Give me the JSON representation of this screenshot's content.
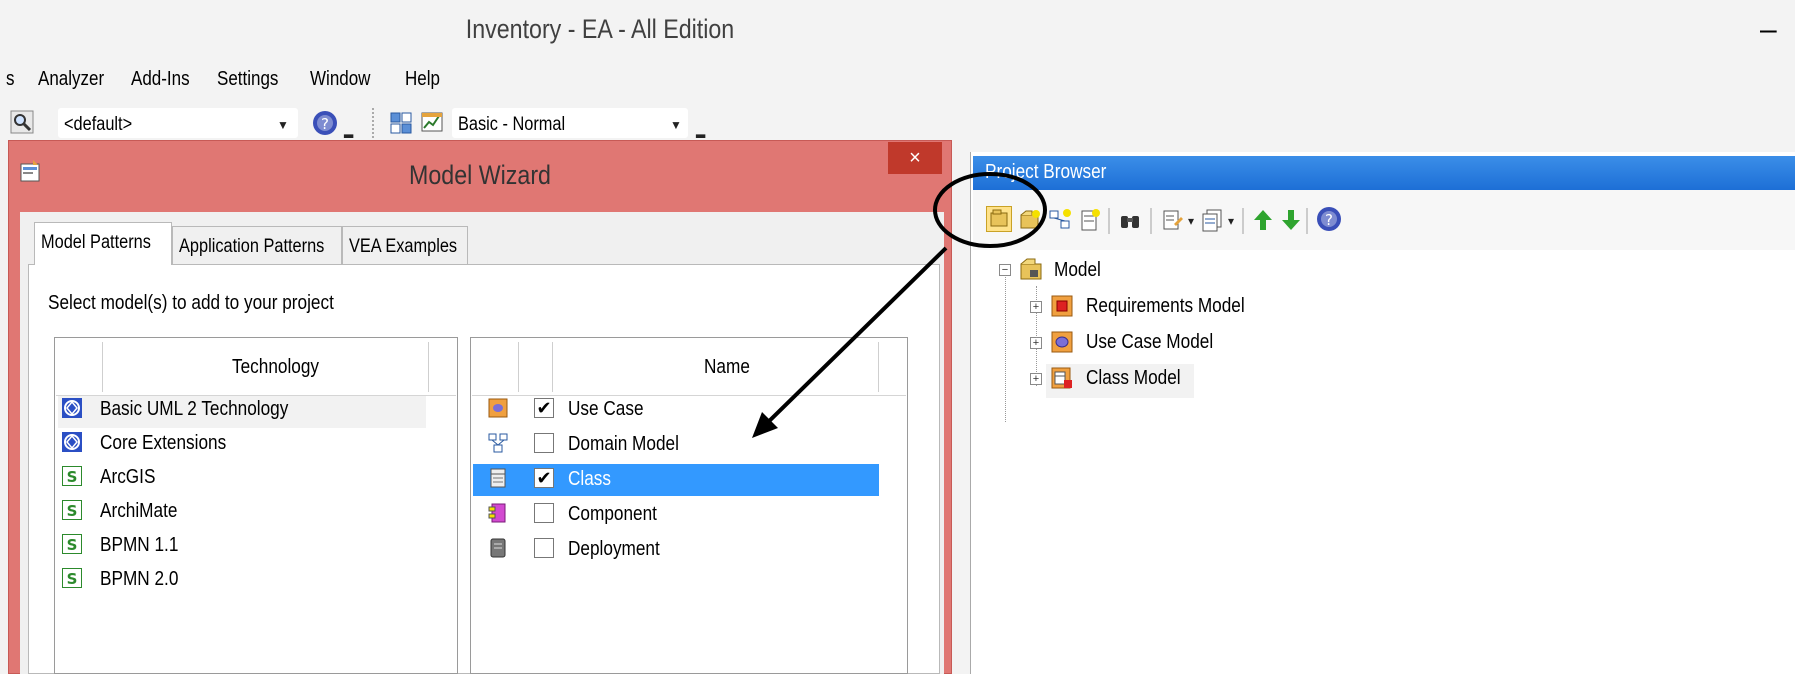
{
  "window": {
    "title": "Inventory - EA - All Edition",
    "minimize_glyph": "–"
  },
  "menubar": {
    "items": [
      "s",
      "Analyzer",
      "Add-Ins",
      "Settings",
      "Window",
      "Help"
    ]
  },
  "toolbar": {
    "perspective": "<default>",
    "workspace": "Basic - Normal"
  },
  "dialog": {
    "title": "Model Wizard",
    "close_glyph": "×",
    "tabs": [
      "Model Patterns",
      "Application Patterns",
      "VEA Examples"
    ],
    "prompt": "Select model(s) to add to your project",
    "technology_header": "Technology",
    "technologies": [
      {
        "label": "Basic UML 2 Technology",
        "icon": "uml-technology-icon",
        "selected": true
      },
      {
        "label": "Core Extensions",
        "icon": "uml-technology-icon",
        "selected": false
      },
      {
        "label": "ArcGIS",
        "icon": "mdg-technology-icon",
        "selected": false
      },
      {
        "label": "ArchiMate",
        "icon": "mdg-technology-icon",
        "selected": false
      },
      {
        "label": "BPMN 1.1",
        "icon": "mdg-technology-icon",
        "selected": false
      },
      {
        "label": "BPMN 2.0",
        "icon": "mdg-technology-icon",
        "selected": false
      }
    ],
    "name_header": "Name",
    "patterns": [
      {
        "label": "Use Case",
        "checked": true,
        "icon": "use-case-icon",
        "selected": false
      },
      {
        "label": "Domain Model",
        "checked": false,
        "icon": "domain-model-icon",
        "selected": false
      },
      {
        "label": "Class",
        "checked": true,
        "icon": "class-icon",
        "selected": true
      },
      {
        "label": "Component",
        "checked": false,
        "icon": "component-icon",
        "selected": false
      },
      {
        "label": "Deployment",
        "checked": false,
        "icon": "deployment-icon",
        "selected": false
      }
    ]
  },
  "project_browser": {
    "title": "Project Browser",
    "root": "Model",
    "packages": [
      "Requirements Model",
      "Use Case Model",
      "Class Model"
    ]
  },
  "colors": {
    "dialog_frame": "#e07773",
    "selection": "#3399ff",
    "header": "#1d6fd6"
  }
}
